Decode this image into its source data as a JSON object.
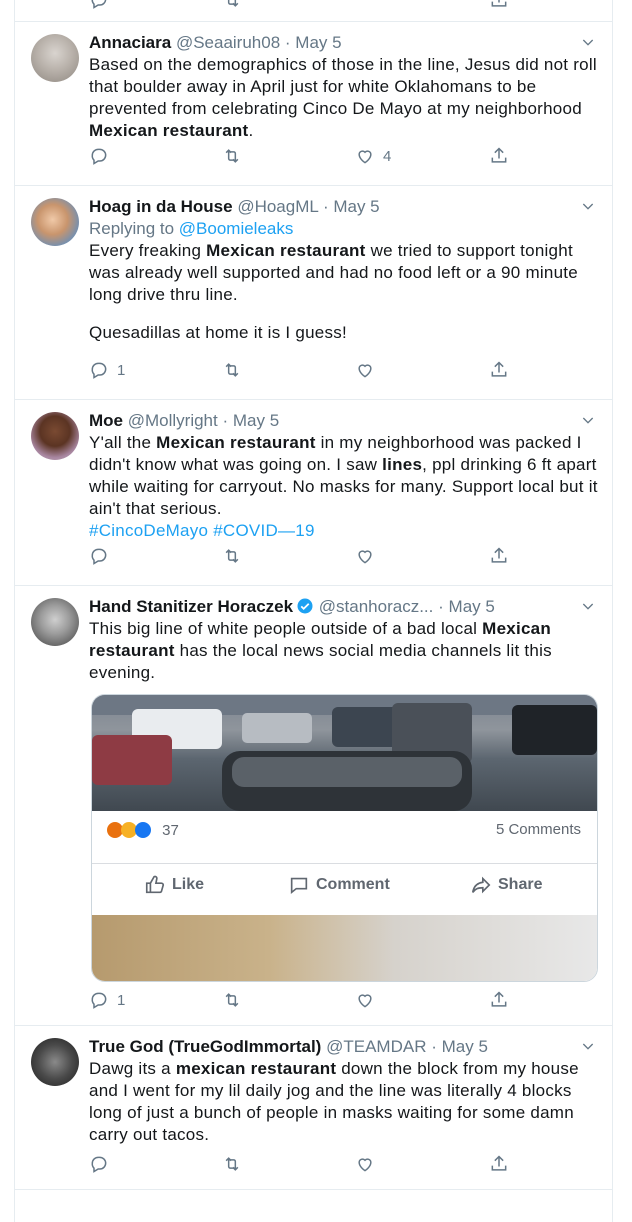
{
  "tweets": [
    {
      "name": "Annaciara",
      "handle": "@Seaairuh08",
      "sep": "·",
      "date": "May 5",
      "text_parts": [
        "Based on the demographics of those in the line, Jesus did not roll that boulder away in April just for white Oklahomans to be prevented from celebrating Cinco De Mayo at my neighborhood ",
        "Mexican restaurant",
        "."
      ],
      "replies": "",
      "retweets": "",
      "likes": "4"
    },
    {
      "name": "Hoag in da House",
      "handle": "@HoagML",
      "sep": "·",
      "date": "May 5",
      "replying_prefix": "Replying to ",
      "replying_to": "@Boomieleaks",
      "text_parts": [
        "Every freaking ",
        "Mexican restaurant",
        " we tried to support tonight was already well supported and had no food left or a 90 minute long drive thru line."
      ],
      "text_para2": "Quesadillas at home it is I guess!",
      "replies": "1",
      "retweets": "",
      "likes": ""
    },
    {
      "name": "Moe",
      "handle": "@Mollyright",
      "sep": "·",
      "date": "May 5",
      "text_parts": [
        "Y'all the ",
        "Mexican restaurant",
        " in my neighborhood was packed I didn't know what was going on. I saw ",
        "lines",
        ", ppl drinking 6 ft apart while waiting for carryout. No masks for many. Support local but it ain't that serious."
      ],
      "hashtags": [
        "#CincoDeMayo",
        "#COVID—19"
      ],
      "replies": "",
      "retweets": "",
      "likes": ""
    },
    {
      "name": "Hand Stanitizer Horaczek",
      "handle": "@stanhoracz...",
      "sep": "·",
      "date": "May 5",
      "text_parts": [
        "This big line of white people outside of a bad local ",
        "Mexican restaurant",
        " has the local news social media channels lit this evening."
      ],
      "media": {
        "reaction_count": "37",
        "comments": "5 Comments",
        "like_label": "Like",
        "comment_label": "Comment",
        "share_label": "Share"
      },
      "replies": "1",
      "retweets": "",
      "likes": ""
    },
    {
      "name": "True God (TrueGodImmortal)",
      "handle": "@TEAMDAR",
      "sep": "·",
      "date": "May 5",
      "text_parts": [
        "Dawg its a ",
        "mexican restaurant",
        " down the block from my house and I went for my lil daily jog and the line was literally 4 blocks long of just a bunch of people in masks waiting for some damn carry out tacos."
      ],
      "replies": "",
      "retweets": "",
      "likes": ""
    }
  ],
  "colors": {
    "link": "#1da1f2",
    "muted": "#657786",
    "border": "#e6ecf0"
  },
  "icons": [
    "reply-icon",
    "retweet-icon",
    "like-icon",
    "share-icon",
    "chevron-down-icon",
    "verified-badge-icon"
  ]
}
